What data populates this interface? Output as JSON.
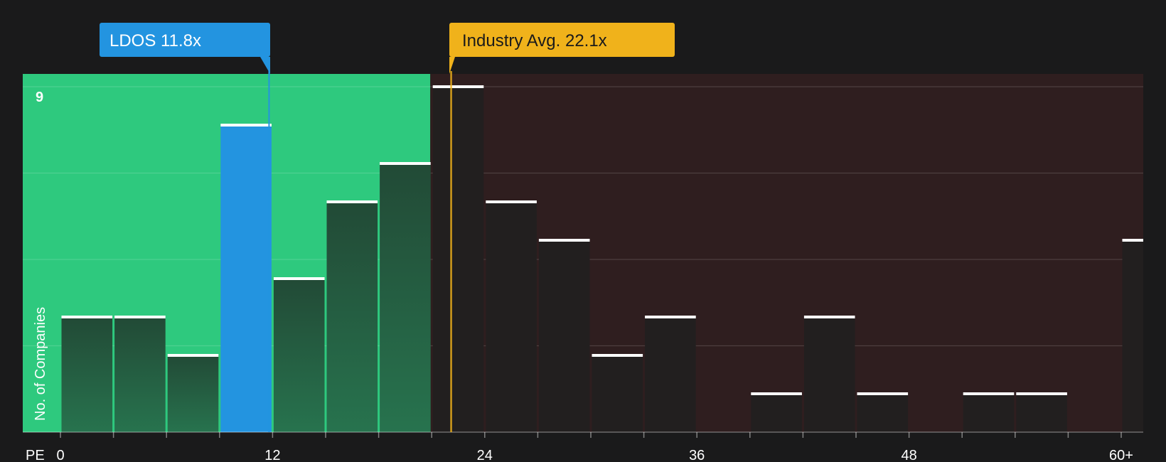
{
  "chart_data": {
    "type": "bar",
    "x_label": "PE",
    "y_label": "No. of Companies",
    "x_ticks": [
      "0",
      "12",
      "24",
      "36",
      "48",
      "60+"
    ],
    "x_range": [
      0,
      60
    ],
    "y_max_label": "9",
    "y_range": [
      0,
      9
    ],
    "bins": [
      {
        "x_start": 0,
        "x_end": 3,
        "count": 3
      },
      {
        "x_start": 3,
        "x_end": 6,
        "count": 3
      },
      {
        "x_start": 6,
        "x_end": 9,
        "count": 2
      },
      {
        "x_start": 9,
        "x_end": 12,
        "count": 8,
        "highlight": true
      },
      {
        "x_start": 12,
        "x_end": 15,
        "count": 4
      },
      {
        "x_start": 15,
        "x_end": 18,
        "count": 6
      },
      {
        "x_start": 18,
        "x_end": 21,
        "count": 7
      },
      {
        "x_start": 21,
        "x_end": 24,
        "count": 9
      },
      {
        "x_start": 24,
        "x_end": 27,
        "count": 6
      },
      {
        "x_start": 27,
        "x_end": 30,
        "count": 5
      },
      {
        "x_start": 30,
        "x_end": 33,
        "count": 2
      },
      {
        "x_start": 33,
        "x_end": 36,
        "count": 3
      },
      {
        "x_start": 36,
        "x_end": 39,
        "count": 0
      },
      {
        "x_start": 39,
        "x_end": 42,
        "count": 1
      },
      {
        "x_start": 42,
        "x_end": 45,
        "count": 3
      },
      {
        "x_start": 45,
        "x_end": 48,
        "count": 1
      },
      {
        "x_start": 48,
        "x_end": 51,
        "count": 0
      },
      {
        "x_start": 51,
        "x_end": 54,
        "count": 1
      },
      {
        "x_start": 54,
        "x_end": 57,
        "count": 1
      },
      {
        "x_start": 57,
        "x_end": 60,
        "count": 0
      },
      {
        "x_start": 60,
        "x_end": 63,
        "count": 5
      }
    ],
    "company": {
      "label": "LDOS 11.8x",
      "value": 11.8
    },
    "industry": {
      "label": "Industry Avg. 22.1x",
      "value": 22.1
    },
    "colors": {
      "background": "#1a1a1b",
      "undervalued_zone": "#2ec97e",
      "overvalued_zone": "#2f1e1f",
      "highlight_bar": "#2394e0",
      "company_callout": "#2394e0",
      "industry_callout": "#f0b21b",
      "bar_cap": "#ffffff"
    }
  }
}
